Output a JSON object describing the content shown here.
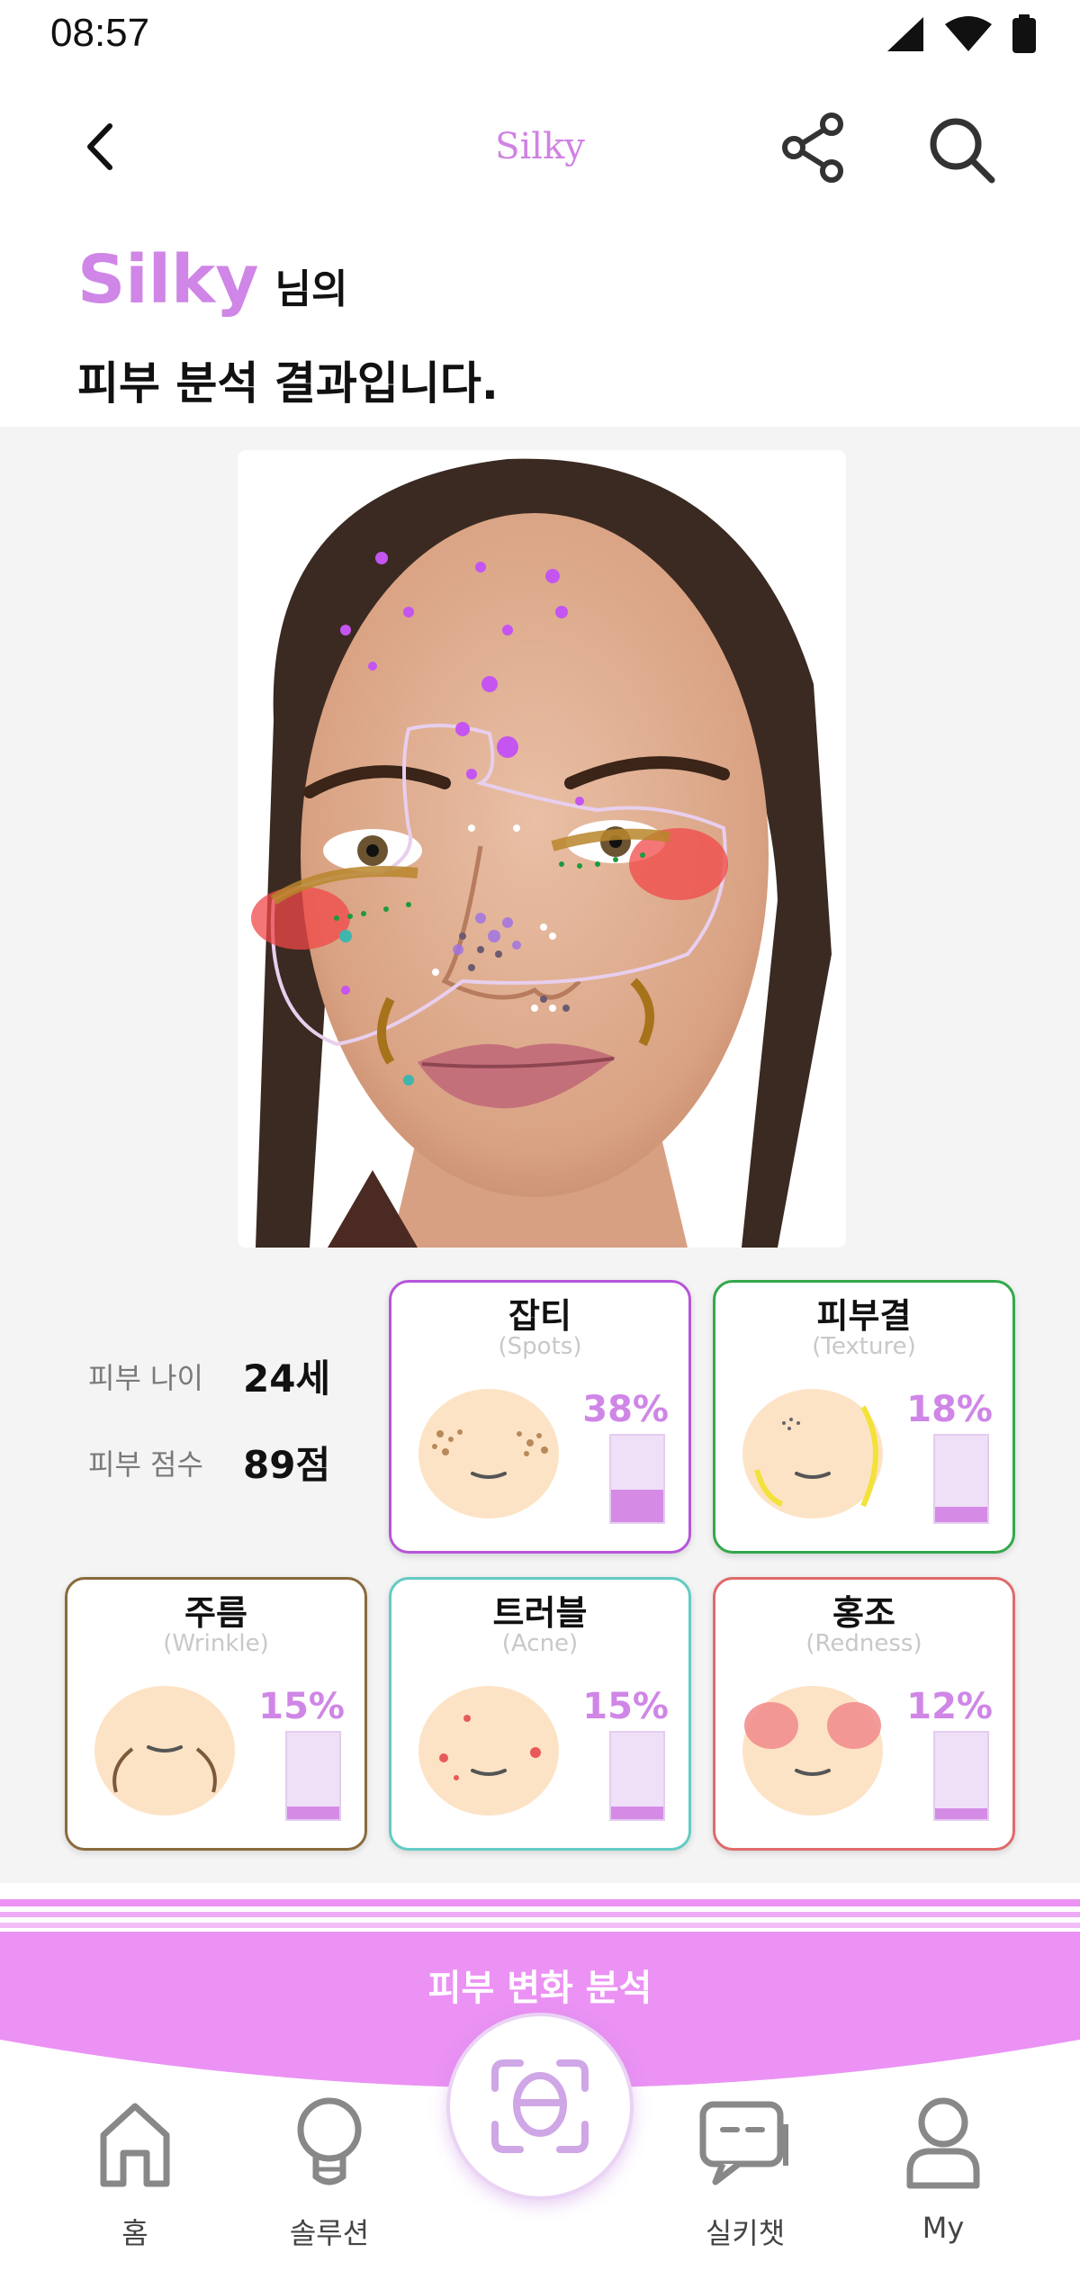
{
  "status_bar": {
    "time": "08:57",
    "icons": [
      "signal-icon",
      "wifi-icon",
      "battery-icon"
    ]
  },
  "header": {
    "title": "Silky",
    "back_icon": "chevron-left-icon",
    "share_icon": "share-icon",
    "search_icon": "search-icon"
  },
  "greeting": {
    "name": "Silky",
    "suffix": "님의",
    "line2": "피부 분석 결과입니다."
  },
  "summary": {
    "age_label": "피부 나이",
    "age_value": "24세",
    "score_label": "피부 점수",
    "score_value": "89점"
  },
  "metrics": [
    {
      "title": "잡티",
      "subtitle": "(Spots)",
      "percent": "38%",
      "level": 0.38,
      "border_color": "#b655d9"
    },
    {
      "title": "피부결",
      "subtitle": "(Texture)",
      "percent": "18%",
      "level": 0.18,
      "border_color": "#33a84a"
    },
    {
      "title": "주름",
      "subtitle": "(Wrinkle)",
      "percent": "15%",
      "level": 0.15,
      "border_color": "#8a6a3c"
    },
    {
      "title": "트러블",
      "subtitle": "(Acne)",
      "percent": "15%",
      "level": 0.15,
      "border_color": "#63cbc3"
    },
    {
      "title": "홍조",
      "subtitle": "(Redness)",
      "percent": "12%",
      "level": 0.12,
      "border_color": "#e06a6a"
    }
  ],
  "analysis_button": {
    "label": "피부 변화 분석"
  },
  "bottom_nav": {
    "items": [
      {
        "label": "홈",
        "icon": "home-icon"
      },
      {
        "label": "솔루션",
        "icon": "lightbulb-icon"
      },
      {
        "label": "",
        "icon": "face-scan-icon"
      },
      {
        "label": "실키챗",
        "icon": "chat-icon"
      },
      {
        "label": "My",
        "icon": "user-icon"
      }
    ]
  },
  "colors": {
    "brand": "#cf86e6",
    "button": "#eb92f4",
    "panel": "#f4f4f4"
  }
}
